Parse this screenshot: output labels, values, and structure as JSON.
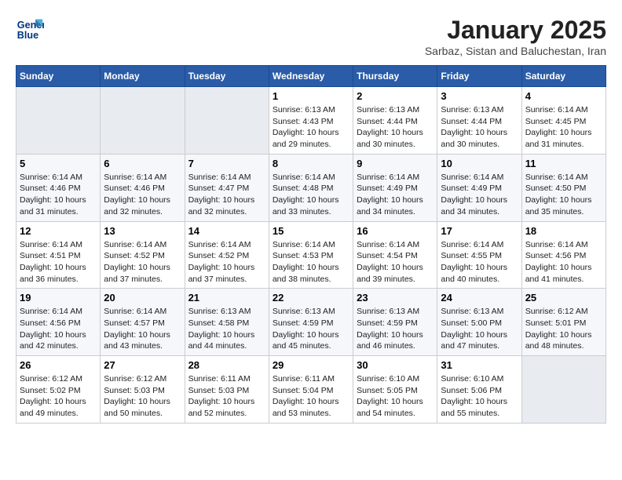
{
  "header": {
    "logo": {
      "line1": "General",
      "line2": "Blue"
    },
    "title": "January 2025",
    "subtitle": "Sarbaz, Sistan and Baluchestan, Iran"
  },
  "weekdays": [
    "Sunday",
    "Monday",
    "Tuesday",
    "Wednesday",
    "Thursday",
    "Friday",
    "Saturday"
  ],
  "weeks": [
    {
      "days": [
        {
          "num": "",
          "info": ""
        },
        {
          "num": "",
          "info": ""
        },
        {
          "num": "",
          "info": ""
        },
        {
          "num": "1",
          "info": "Sunrise: 6:13 AM\nSunset: 4:43 PM\nDaylight: 10 hours\nand 29 minutes."
        },
        {
          "num": "2",
          "info": "Sunrise: 6:13 AM\nSunset: 4:44 PM\nDaylight: 10 hours\nand 30 minutes."
        },
        {
          "num": "3",
          "info": "Sunrise: 6:13 AM\nSunset: 4:44 PM\nDaylight: 10 hours\nand 30 minutes."
        },
        {
          "num": "4",
          "info": "Sunrise: 6:14 AM\nSunset: 4:45 PM\nDaylight: 10 hours\nand 31 minutes."
        }
      ]
    },
    {
      "days": [
        {
          "num": "5",
          "info": "Sunrise: 6:14 AM\nSunset: 4:46 PM\nDaylight: 10 hours\nand 31 minutes."
        },
        {
          "num": "6",
          "info": "Sunrise: 6:14 AM\nSunset: 4:46 PM\nDaylight: 10 hours\nand 32 minutes."
        },
        {
          "num": "7",
          "info": "Sunrise: 6:14 AM\nSunset: 4:47 PM\nDaylight: 10 hours\nand 32 minutes."
        },
        {
          "num": "8",
          "info": "Sunrise: 6:14 AM\nSunset: 4:48 PM\nDaylight: 10 hours\nand 33 minutes."
        },
        {
          "num": "9",
          "info": "Sunrise: 6:14 AM\nSunset: 4:49 PM\nDaylight: 10 hours\nand 34 minutes."
        },
        {
          "num": "10",
          "info": "Sunrise: 6:14 AM\nSunset: 4:49 PM\nDaylight: 10 hours\nand 34 minutes."
        },
        {
          "num": "11",
          "info": "Sunrise: 6:14 AM\nSunset: 4:50 PM\nDaylight: 10 hours\nand 35 minutes."
        }
      ]
    },
    {
      "days": [
        {
          "num": "12",
          "info": "Sunrise: 6:14 AM\nSunset: 4:51 PM\nDaylight: 10 hours\nand 36 minutes."
        },
        {
          "num": "13",
          "info": "Sunrise: 6:14 AM\nSunset: 4:52 PM\nDaylight: 10 hours\nand 37 minutes."
        },
        {
          "num": "14",
          "info": "Sunrise: 6:14 AM\nSunset: 4:52 PM\nDaylight: 10 hours\nand 37 minutes."
        },
        {
          "num": "15",
          "info": "Sunrise: 6:14 AM\nSunset: 4:53 PM\nDaylight: 10 hours\nand 38 minutes."
        },
        {
          "num": "16",
          "info": "Sunrise: 6:14 AM\nSunset: 4:54 PM\nDaylight: 10 hours\nand 39 minutes."
        },
        {
          "num": "17",
          "info": "Sunrise: 6:14 AM\nSunset: 4:55 PM\nDaylight: 10 hours\nand 40 minutes."
        },
        {
          "num": "18",
          "info": "Sunrise: 6:14 AM\nSunset: 4:56 PM\nDaylight: 10 hours\nand 41 minutes."
        }
      ]
    },
    {
      "days": [
        {
          "num": "19",
          "info": "Sunrise: 6:14 AM\nSunset: 4:56 PM\nDaylight: 10 hours\nand 42 minutes."
        },
        {
          "num": "20",
          "info": "Sunrise: 6:14 AM\nSunset: 4:57 PM\nDaylight: 10 hours\nand 43 minutes."
        },
        {
          "num": "21",
          "info": "Sunrise: 6:13 AM\nSunset: 4:58 PM\nDaylight: 10 hours\nand 44 minutes."
        },
        {
          "num": "22",
          "info": "Sunrise: 6:13 AM\nSunset: 4:59 PM\nDaylight: 10 hours\nand 45 minutes."
        },
        {
          "num": "23",
          "info": "Sunrise: 6:13 AM\nSunset: 4:59 PM\nDaylight: 10 hours\nand 46 minutes."
        },
        {
          "num": "24",
          "info": "Sunrise: 6:13 AM\nSunset: 5:00 PM\nDaylight: 10 hours\nand 47 minutes."
        },
        {
          "num": "25",
          "info": "Sunrise: 6:12 AM\nSunset: 5:01 PM\nDaylight: 10 hours\nand 48 minutes."
        }
      ]
    },
    {
      "days": [
        {
          "num": "26",
          "info": "Sunrise: 6:12 AM\nSunset: 5:02 PM\nDaylight: 10 hours\nand 49 minutes."
        },
        {
          "num": "27",
          "info": "Sunrise: 6:12 AM\nSunset: 5:03 PM\nDaylight: 10 hours\nand 50 minutes."
        },
        {
          "num": "28",
          "info": "Sunrise: 6:11 AM\nSunset: 5:03 PM\nDaylight: 10 hours\nand 52 minutes."
        },
        {
          "num": "29",
          "info": "Sunrise: 6:11 AM\nSunset: 5:04 PM\nDaylight: 10 hours\nand 53 minutes."
        },
        {
          "num": "30",
          "info": "Sunrise: 6:10 AM\nSunset: 5:05 PM\nDaylight: 10 hours\nand 54 minutes."
        },
        {
          "num": "31",
          "info": "Sunrise: 6:10 AM\nSunset: 5:06 PM\nDaylight: 10 hours\nand 55 minutes."
        },
        {
          "num": "",
          "info": ""
        }
      ]
    }
  ]
}
